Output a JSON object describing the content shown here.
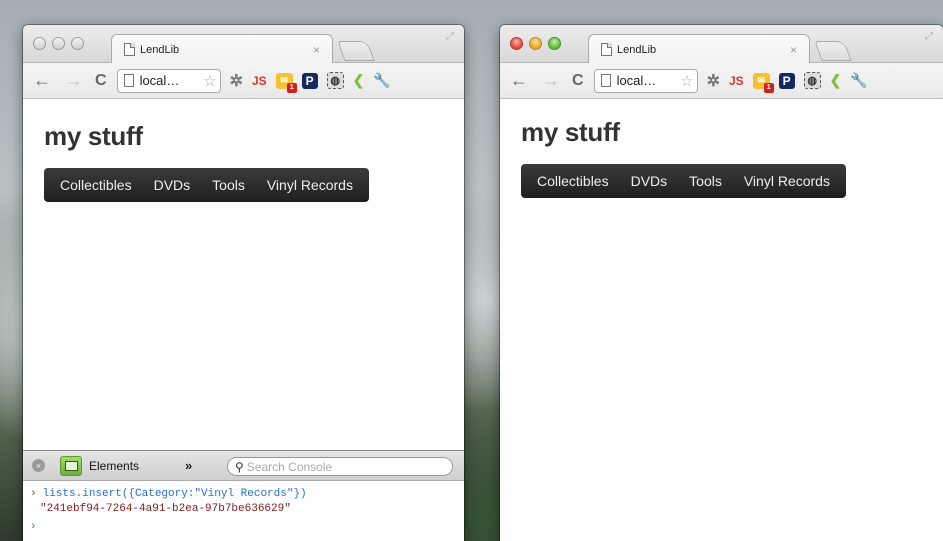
{
  "windows": [
    {
      "tab_title": "LendLib",
      "tab_close": "×",
      "url": "local…",
      "page": {
        "heading": "my stuff",
        "categories": [
          "Collectibles",
          "DVDs",
          "Tools",
          "Vinyl Records"
        ]
      },
      "devtools": {
        "close_glyph": "×",
        "panel_label": "Elements",
        "more_glyph": "»",
        "search_placeholder": "Search Console",
        "console_input": "lists.insert({Category:\"Vinyl Records\"})",
        "console_output": "\"241ebf94-7264-4a91-b2ea-97b7be636629\"",
        "input_prompt": "›",
        "prompt": "›"
      }
    },
    {
      "tab_title": "LendLib",
      "tab_close": "×",
      "url": "local…",
      "page": {
        "heading": "my stuff",
        "categories": [
          "Collectibles",
          "DVDs",
          "Tools",
          "Vinyl Records"
        ]
      }
    }
  ],
  "toolbar": {
    "back": "←",
    "forward": "→",
    "reload": "C",
    "star": "☆",
    "ext_js": "JS",
    "ext_mail_badge": "1",
    "ext_p": "P",
    "ext_wrench": "🔧"
  },
  "icons": [
    "back-icon",
    "forward-icon",
    "reload-icon",
    "page-icon",
    "star-icon",
    "bug-icon",
    "js-icon",
    "mail-icon",
    "p-icon",
    "evernote-icon",
    "leaf-icon",
    "wrench-icon",
    "elements-icon",
    "search-icon"
  ],
  "colors": {
    "navbar": "#2b2b2b",
    "console_input": "#2a6fd3",
    "console_output": "#8b1a1a",
    "close_red": "#e2463b",
    "minimize_yellow": "#e9a627",
    "zoom_green": "#61b93f"
  }
}
